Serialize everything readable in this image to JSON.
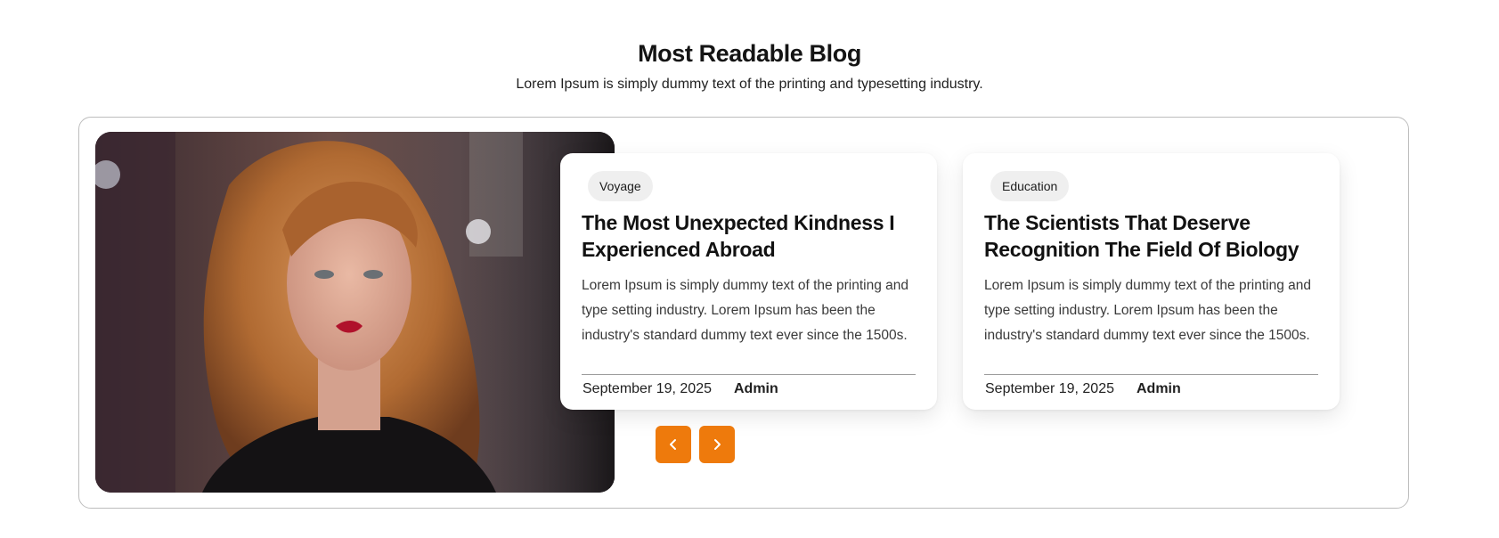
{
  "section": {
    "title": "Most Readable Blog",
    "subtitle": "Lorem Ipsum is simply dummy text of the printing and typesetting industry."
  },
  "posts": [
    {
      "category": "Voyage",
      "title": "The Most Unexpected Kindness I Experienced Abroad",
      "excerpt": "Lorem Ipsum is simply dummy text of the printing and type setting industry. Lorem Ipsum has been the industry's standard dummy text ever since the 1500s.",
      "date": "September 19, 2025",
      "author": "Admin"
    },
    {
      "category": "Education",
      "title": "The Scientists That Deserve Recognition The Field Of Biology",
      "excerpt": "Lorem Ipsum is simply dummy text of the printing and type setting industry. Lorem Ipsum has been the industry's standard dummy text ever since the 1500s.",
      "date": "September 19, 2025",
      "author": "Admin"
    }
  ],
  "carousel": {
    "prev_icon": "chevron-left-icon",
    "next_icon": "chevron-right-icon",
    "accent_color": "#EE7A0C"
  },
  "featured_image": {
    "subject": "portrait photo of a woman with long wavy auburn hair and red lipstick"
  }
}
